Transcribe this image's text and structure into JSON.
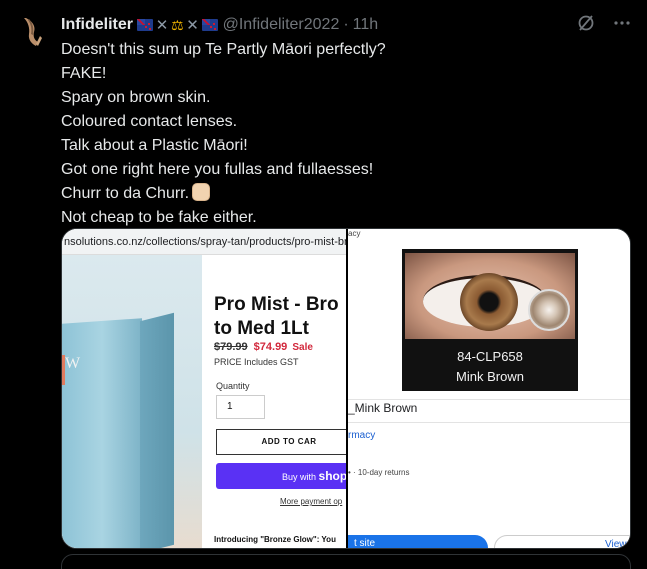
{
  "tweet": {
    "display_name": "Infideliter",
    "handle": "@Infideliter2022",
    "separator": "·",
    "time": "11h",
    "header_emoji": [
      "nz-flag-icon",
      "x-mark-icon",
      "scales-icon",
      "x-mark-icon",
      "nz-flag-icon"
    ],
    "lines": [
      "Doesn't this sum up Te Partly Māori perfectly?",
      "FAKE!",
      "Spary on brown skin.",
      "Coloured contact lenses.",
      "Talk about a Plastic Māori!",
      "Got one right here you fullas and fullaesses!",
      "Churr to da Churr.",
      "Not cheap to be fake either."
    ],
    "churr_emoji": "raised-fist-icon"
  },
  "media": {
    "left": {
      "url": "nsolutions.co.nz/collections/spray-tan/products/pro-mist-br",
      "title_line1": "Pro Mist - Bro",
      "title_line2": "to Med 1Lt",
      "price_old": "$79.99",
      "price_new": "$74.99",
      "sale_label": "Sale",
      "gst_note": "PRICE Includes GST",
      "quantity_label": "Quantity",
      "quantity_value": "1",
      "add_to_cart": "ADD TO CAR",
      "shop_pay_prefix": "Buy with",
      "shop_pay_brand": "shop",
      "more_payment": "More payment op",
      "intro": "Introducing \"Bronze Glow\": You",
      "box_letter": "W"
    },
    "right": {
      "url_fragment": "acy",
      "lens_code": "84-CLP658",
      "lens_name": "Mink Brown",
      "title": "_Mink Brown",
      "seller": "rmacy",
      "returns": "• · 10-day returns",
      "visit_button": "t site",
      "view_button": "View"
    }
  },
  "colors": {
    "background": "#000000",
    "text_primary": "#e7e9ea",
    "text_secondary": "#71767b",
    "sale_red": "#d2283c",
    "shop_pay_purple": "#5a31f4",
    "link_blue": "#1a5fd0"
  }
}
